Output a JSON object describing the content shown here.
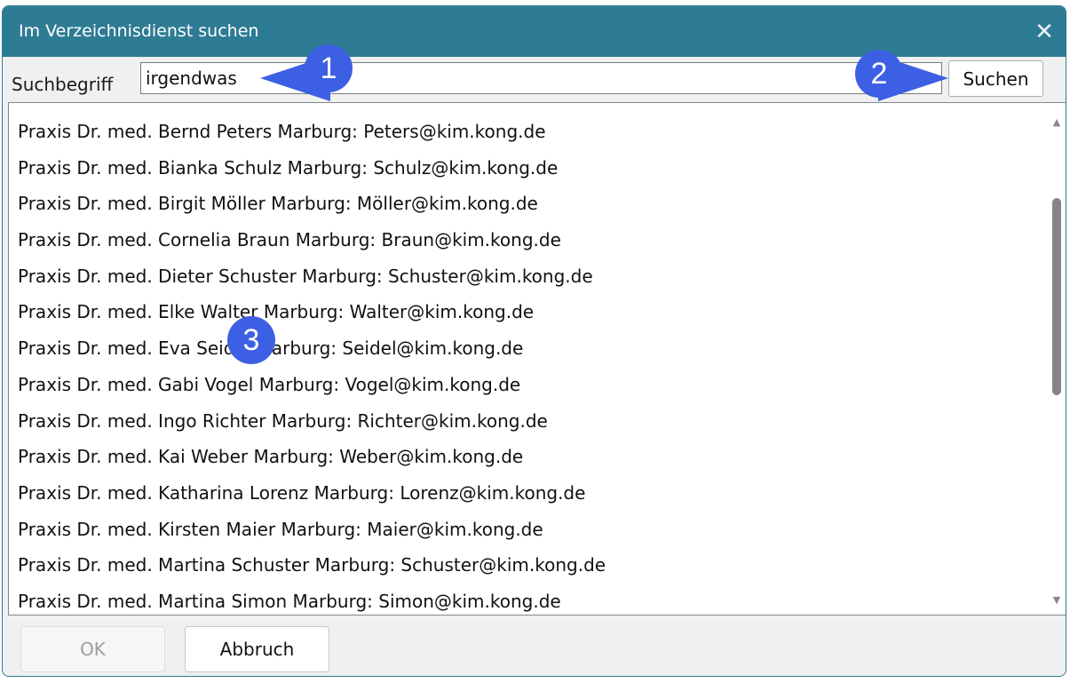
{
  "window": {
    "title": "Im Verzeichnisdienst suchen",
    "close_icon": "close-icon"
  },
  "search": {
    "label": "Suchbegriff",
    "value": "irgendwas",
    "button_label": "Suchen"
  },
  "results": [
    "Praxis Dr. med. Bernd Peters Marburg: Peters@kim.kong.de",
    "Praxis Dr. med. Bianka Schulz Marburg: Schulz@kim.kong.de",
    "Praxis Dr. med. Birgit Möller Marburg: Möller@kim.kong.de",
    "Praxis Dr. med. Cornelia Braun Marburg: Braun@kim.kong.de",
    "Praxis Dr. med. Dieter Schuster Marburg: Schuster@kim.kong.de",
    "Praxis Dr. med. Elke Walter Marburg: Walter@kim.kong.de",
    "Praxis Dr. med. Eva Seidel Marburg: Seidel@kim.kong.de",
    "Praxis Dr. med. Gabi Vogel Marburg: Vogel@kim.kong.de",
    "Praxis Dr. med. Ingo Richter Marburg: Richter@kim.kong.de",
    "Praxis Dr. med. Kai Weber Marburg: Weber@kim.kong.de",
    "Praxis Dr. med. Katharina Lorenz Marburg: Lorenz@kim.kong.de",
    "Praxis Dr. med. Kirsten Maier Marburg: Maier@kim.kong.de",
    "Praxis Dr. med. Martina Schuster Marburg: Schuster@kim.kong.de",
    "Praxis Dr. med. Martina Simon Marburg: Simon@kim.kong.de"
  ],
  "footer": {
    "ok_label": "OK",
    "cancel_label": "Abbruch"
  },
  "annotations": {
    "marker_1": "1",
    "marker_2": "2",
    "marker_3": "3"
  },
  "colors": {
    "titlebar": "#2e7b94",
    "marker": "#3d5fe3"
  }
}
